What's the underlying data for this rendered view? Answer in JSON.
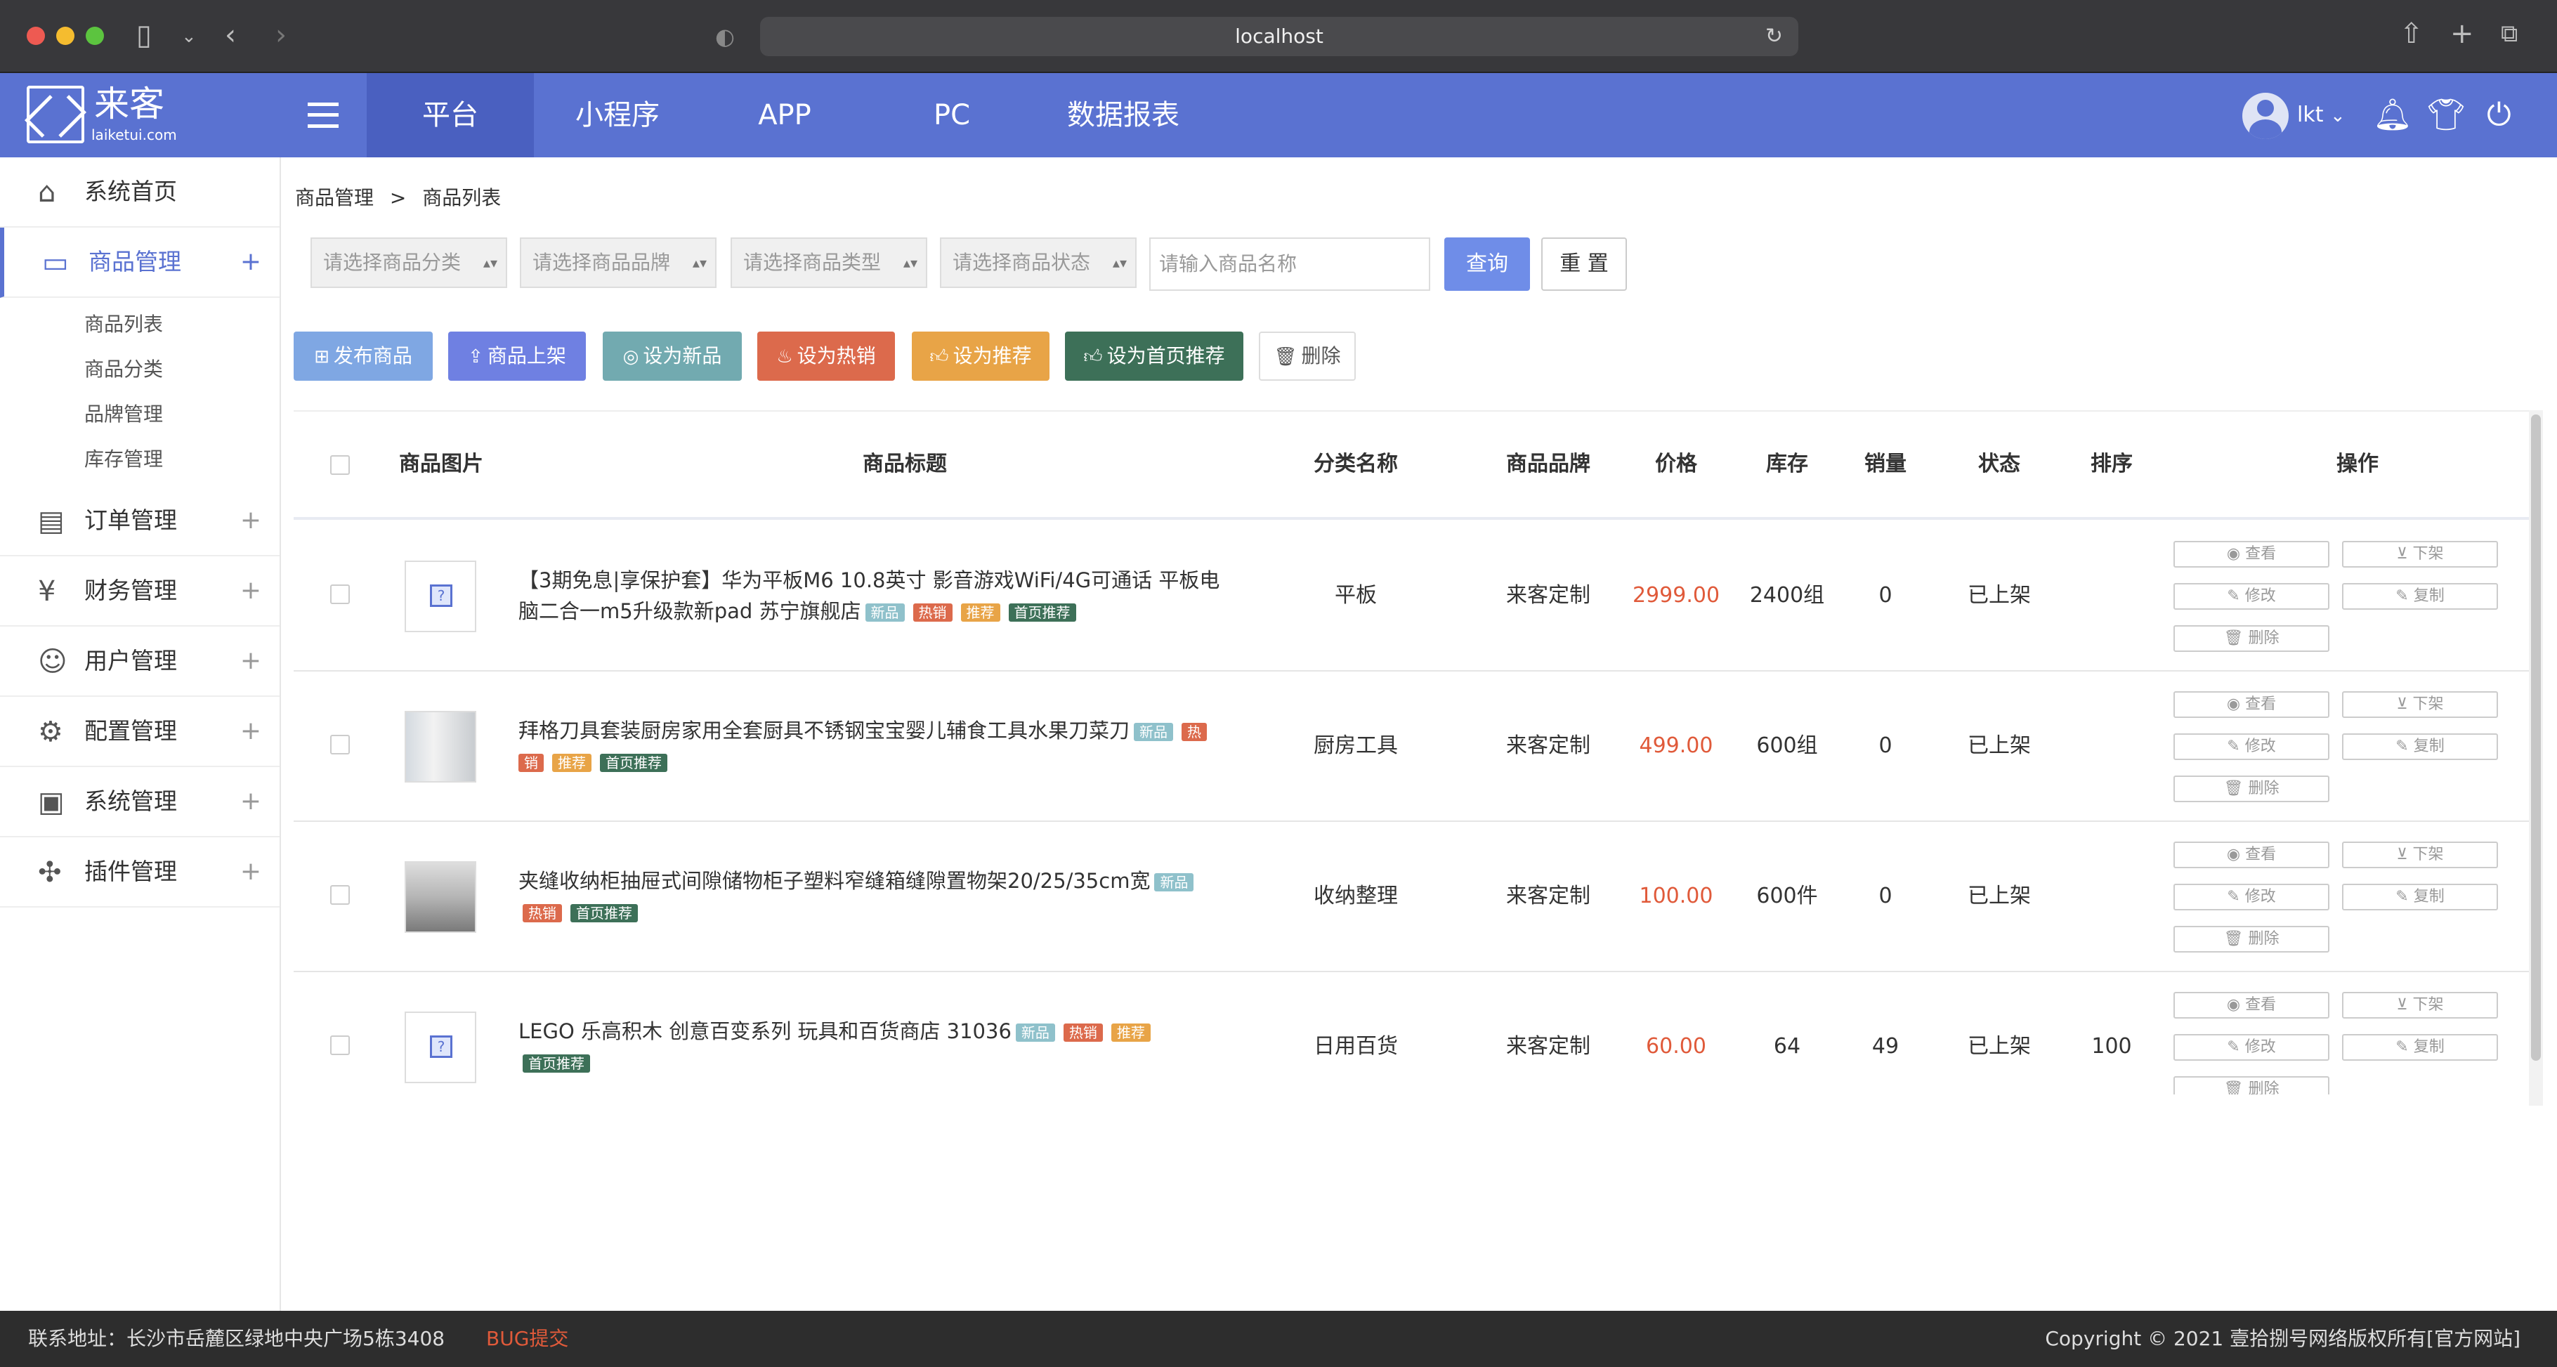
{
  "browser": {
    "url": "localhost"
  },
  "header": {
    "logo_text": "来客",
    "logo_sub": "laiketui.com",
    "nav": [
      "平台",
      "小程序",
      "APP",
      "PC",
      "数据报表"
    ],
    "user": "lkt",
    "accent": "#5a72d1"
  },
  "sidebar": {
    "items": [
      {
        "label": "系统首页",
        "icon": "home-icon"
      },
      {
        "label": "商品管理",
        "icon": "briefcase-icon"
      },
      {
        "label": "订单管理",
        "icon": "order-icon"
      },
      {
        "label": "财务管理",
        "icon": "finance-icon"
      },
      {
        "label": "用户管理",
        "icon": "user-icon"
      },
      {
        "label": "配置管理",
        "icon": "config-icon"
      },
      {
        "label": "系统管理",
        "icon": "monitor-icon"
      },
      {
        "label": "插件管理",
        "icon": "plugin-icon"
      }
    ],
    "sub_items": [
      "商品列表",
      "商品分类",
      "品牌管理",
      "库存管理"
    ]
  },
  "breadcrumb": {
    "parent": "商品管理",
    "sep": ">",
    "current": "商品列表"
  },
  "filters": {
    "category": "请选择商品分类",
    "brand": "请选择商品品牌",
    "type": "请选择商品类型",
    "status": "请选择商品状态",
    "name_placeholder": "请输入商品名称",
    "query": "查询",
    "reset": "重 置"
  },
  "actions": [
    {
      "label": "发布商品",
      "color": "#7fa7e3"
    },
    {
      "label": "商品上架",
      "color": "#6f80e2"
    },
    {
      "label": "设为新品",
      "color": "#72aab0"
    },
    {
      "label": "设为热销",
      "color": "#dc6a4c"
    },
    {
      "label": "设为推荐",
      "color": "#e8a447"
    },
    {
      "label": "设为首页推荐",
      "color": "#3d7058"
    },
    {
      "label": "删除",
      "color": "#ffffff"
    }
  ],
  "table": {
    "headers": [
      "商品图片",
      "商品标题",
      "分类名称",
      "商品品牌",
      "价格",
      "库存",
      "销量",
      "状态",
      "排序",
      "操作"
    ],
    "tags": {
      "new": "新品",
      "hot": "热销",
      "rec": "推荐",
      "home": "首页推荐"
    },
    "ops": {
      "view": "查看",
      "off": "下架",
      "edit": "修改",
      "copy": "复制",
      "del": "删除"
    },
    "rows": [
      {
        "title1": "【3期免息|享保护套】华为平板M6 10.8英寸 影音游戏WiFi/4G可通话 平板电",
        "title2": "脑二合一m5升级款新pad 苏宁旗舰店",
        "category": "平板",
        "brand": "来客定制",
        "price": "2999.00",
        "stock": "2400组",
        "sales": "0",
        "status": "已上架",
        "sort": ""
      },
      {
        "title1": "拜格刀具套装厨房家用全套厨具不锈钢宝宝婴儿辅食工具水果刀菜刀",
        "title2": "",
        "category": "厨房工具",
        "brand": "来客定制",
        "price": "499.00",
        "stock": "600组",
        "sales": "0",
        "status": "已上架",
        "sort": "",
        "hot_split1": "热",
        "hot_split2": "销"
      },
      {
        "title1": "夹缝收纳柜抽屉式间隙储物柜子塑料窄缝箱缝隙置物架20/25/35cm宽",
        "title2": "",
        "category": "收纳整理",
        "brand": "来客定制",
        "price": "100.00",
        "stock": "600件",
        "sales": "0",
        "status": "已上架",
        "sort": ""
      },
      {
        "title1": "LEGO 乐高积木 创意百变系列 玩具和百货商店 31036",
        "title2": "",
        "category": "日用百货",
        "brand": "来客定制",
        "price": "60.00",
        "stock": "64",
        "sales": "49",
        "status": "已上架",
        "sort": "100"
      }
    ]
  },
  "footer": {
    "address": "联系地址：长沙市岳麓区绿地中央广场5栋3408",
    "bug": "BUG提交",
    "copyright": "Copyright © 2021 壹拾捌号网络版权所有[官方网站]"
  }
}
